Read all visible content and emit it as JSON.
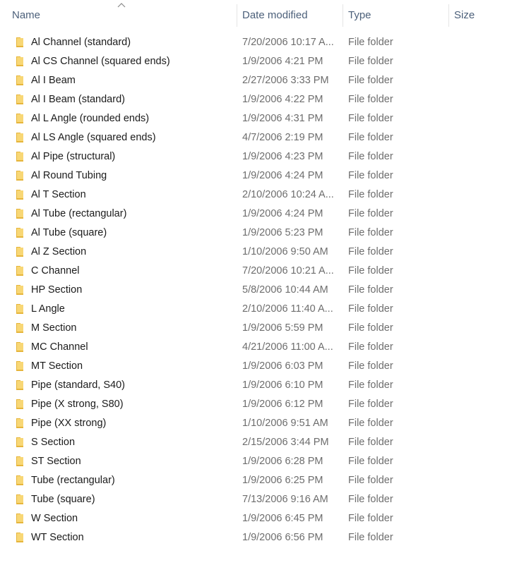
{
  "columns": {
    "name": "Name",
    "date": "Date modified",
    "type": "Type",
    "size": "Size"
  },
  "sort": {
    "column": "name",
    "direction": "ascending",
    "icon": "chevron-up-icon"
  },
  "colors": {
    "header_text": "#4c607a",
    "name_text": "#1b1b1b",
    "detail_text": "#6d6d6d",
    "folder_yellow": "#f8d775",
    "folder_dark": "#e6b53b"
  },
  "files": [
    {
      "name": "Al Channel (standard)",
      "date": "7/20/2006 10:17 A...",
      "type": "File folder",
      "size": "",
      "icon": "folder-icon"
    },
    {
      "name": "Al CS Channel (squared ends)",
      "date": "1/9/2006 4:21 PM",
      "type": "File folder",
      "size": "",
      "icon": "folder-icon"
    },
    {
      "name": "Al I Beam",
      "date": "2/27/2006 3:33 PM",
      "type": "File folder",
      "size": "",
      "icon": "folder-icon"
    },
    {
      "name": "Al I Beam (standard)",
      "date": "1/9/2006 4:22 PM",
      "type": "File folder",
      "size": "",
      "icon": "folder-icon"
    },
    {
      "name": "Al L Angle (rounded ends)",
      "date": "1/9/2006 4:31 PM",
      "type": "File folder",
      "size": "",
      "icon": "folder-icon"
    },
    {
      "name": "Al LS Angle (squared ends)",
      "date": "4/7/2006 2:19 PM",
      "type": "File folder",
      "size": "",
      "icon": "folder-icon"
    },
    {
      "name": "Al Pipe (structural)",
      "date": "1/9/2006 4:23 PM",
      "type": "File folder",
      "size": "",
      "icon": "folder-icon"
    },
    {
      "name": "Al Round Tubing",
      "date": "1/9/2006 4:24 PM",
      "type": "File folder",
      "size": "",
      "icon": "folder-icon"
    },
    {
      "name": "Al T Section",
      "date": "2/10/2006 10:24 A...",
      "type": "File folder",
      "size": "",
      "icon": "folder-icon"
    },
    {
      "name": "Al Tube (rectangular)",
      "date": "1/9/2006 4:24 PM",
      "type": "File folder",
      "size": "",
      "icon": "folder-icon"
    },
    {
      "name": "Al Tube (square)",
      "date": "1/9/2006 5:23 PM",
      "type": "File folder",
      "size": "",
      "icon": "folder-icon"
    },
    {
      "name": "Al Z Section",
      "date": "1/10/2006 9:50 AM",
      "type": "File folder",
      "size": "",
      "icon": "folder-icon"
    },
    {
      "name": "C Channel",
      "date": "7/20/2006 10:21 A...",
      "type": "File folder",
      "size": "",
      "icon": "folder-icon"
    },
    {
      "name": "HP Section",
      "date": "5/8/2006 10:44 AM",
      "type": "File folder",
      "size": "",
      "icon": "folder-icon"
    },
    {
      "name": "L Angle",
      "date": "2/10/2006 11:40 A...",
      "type": "File folder",
      "size": "",
      "icon": "folder-icon"
    },
    {
      "name": "M Section",
      "date": "1/9/2006 5:59 PM",
      "type": "File folder",
      "size": "",
      "icon": "folder-icon"
    },
    {
      "name": "MC Channel",
      "date": "4/21/2006 11:00 A...",
      "type": "File folder",
      "size": "",
      "icon": "folder-icon"
    },
    {
      "name": "MT Section",
      "date": "1/9/2006 6:03 PM",
      "type": "File folder",
      "size": "",
      "icon": "folder-icon"
    },
    {
      "name": "Pipe (standard, S40)",
      "date": "1/9/2006 6:10 PM",
      "type": "File folder",
      "size": "",
      "icon": "folder-icon"
    },
    {
      "name": "Pipe (X strong, S80)",
      "date": "1/9/2006 6:12 PM",
      "type": "File folder",
      "size": "",
      "icon": "folder-icon"
    },
    {
      "name": "Pipe (XX strong)",
      "date": "1/10/2006 9:51 AM",
      "type": "File folder",
      "size": "",
      "icon": "folder-icon"
    },
    {
      "name": "S Section",
      "date": "2/15/2006 3:44 PM",
      "type": "File folder",
      "size": "",
      "icon": "folder-icon"
    },
    {
      "name": "ST Section",
      "date": "1/9/2006 6:28 PM",
      "type": "File folder",
      "size": "",
      "icon": "folder-icon"
    },
    {
      "name": "Tube (rectangular)",
      "date": "1/9/2006 6:25 PM",
      "type": "File folder",
      "size": "",
      "icon": "folder-icon"
    },
    {
      "name": "Tube (square)",
      "date": "7/13/2006 9:16 AM",
      "type": "File folder",
      "size": "",
      "icon": "folder-icon"
    },
    {
      "name": "W Section",
      "date": "1/9/2006 6:45 PM",
      "type": "File folder",
      "size": "",
      "icon": "folder-icon"
    },
    {
      "name": "WT Section",
      "date": "1/9/2006 6:56 PM",
      "type": "File folder",
      "size": "",
      "icon": "folder-icon"
    }
  ]
}
